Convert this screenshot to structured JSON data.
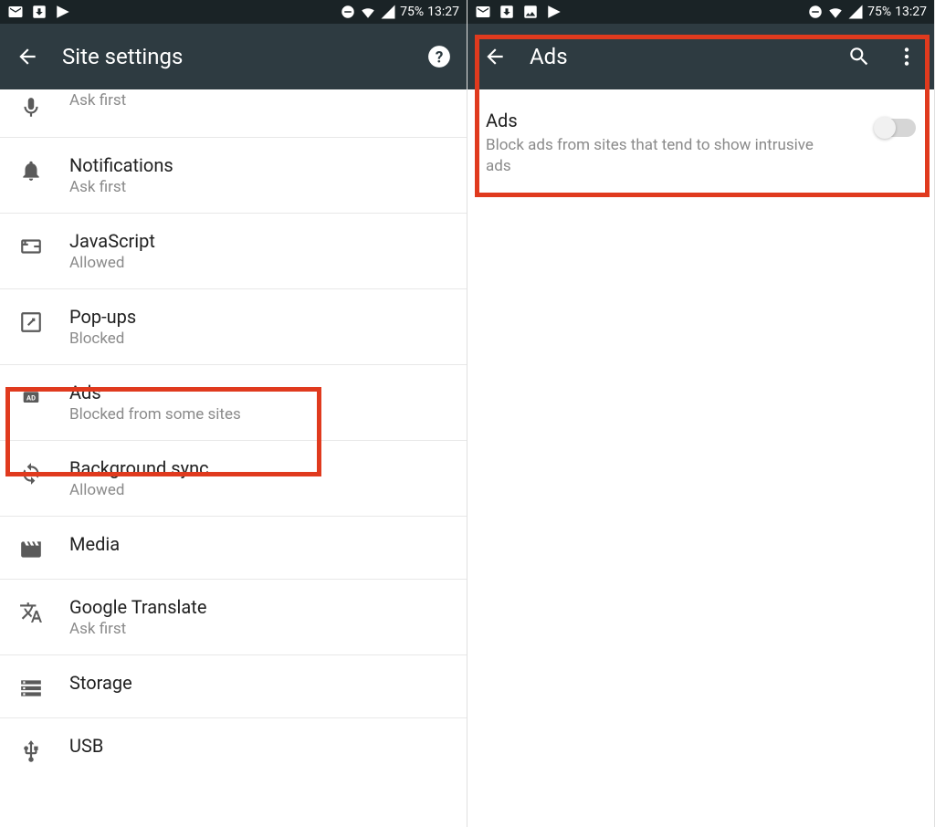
{
  "status": {
    "battery": "75%",
    "time": "13:27"
  },
  "left": {
    "title": "Site settings",
    "items": [
      {
        "title": "Microphone",
        "subtitle": "Ask first"
      },
      {
        "title": "Notifications",
        "subtitle": "Ask first"
      },
      {
        "title": "JavaScript",
        "subtitle": "Allowed"
      },
      {
        "title": "Pop-ups",
        "subtitle": "Blocked"
      },
      {
        "title": "Ads",
        "subtitle": "Blocked from some sites"
      },
      {
        "title": "Background sync",
        "subtitle": "Allowed"
      },
      {
        "title": "Media",
        "subtitle": ""
      },
      {
        "title": "Google Translate",
        "subtitle": "Ask first"
      },
      {
        "title": "Storage",
        "subtitle": ""
      },
      {
        "title": "USB",
        "subtitle": ""
      }
    ]
  },
  "right": {
    "title": "Ads",
    "toggle": {
      "title": "Ads",
      "subtitle": "Block ads from sites that tend to show intrusive ads",
      "enabled": false
    }
  }
}
